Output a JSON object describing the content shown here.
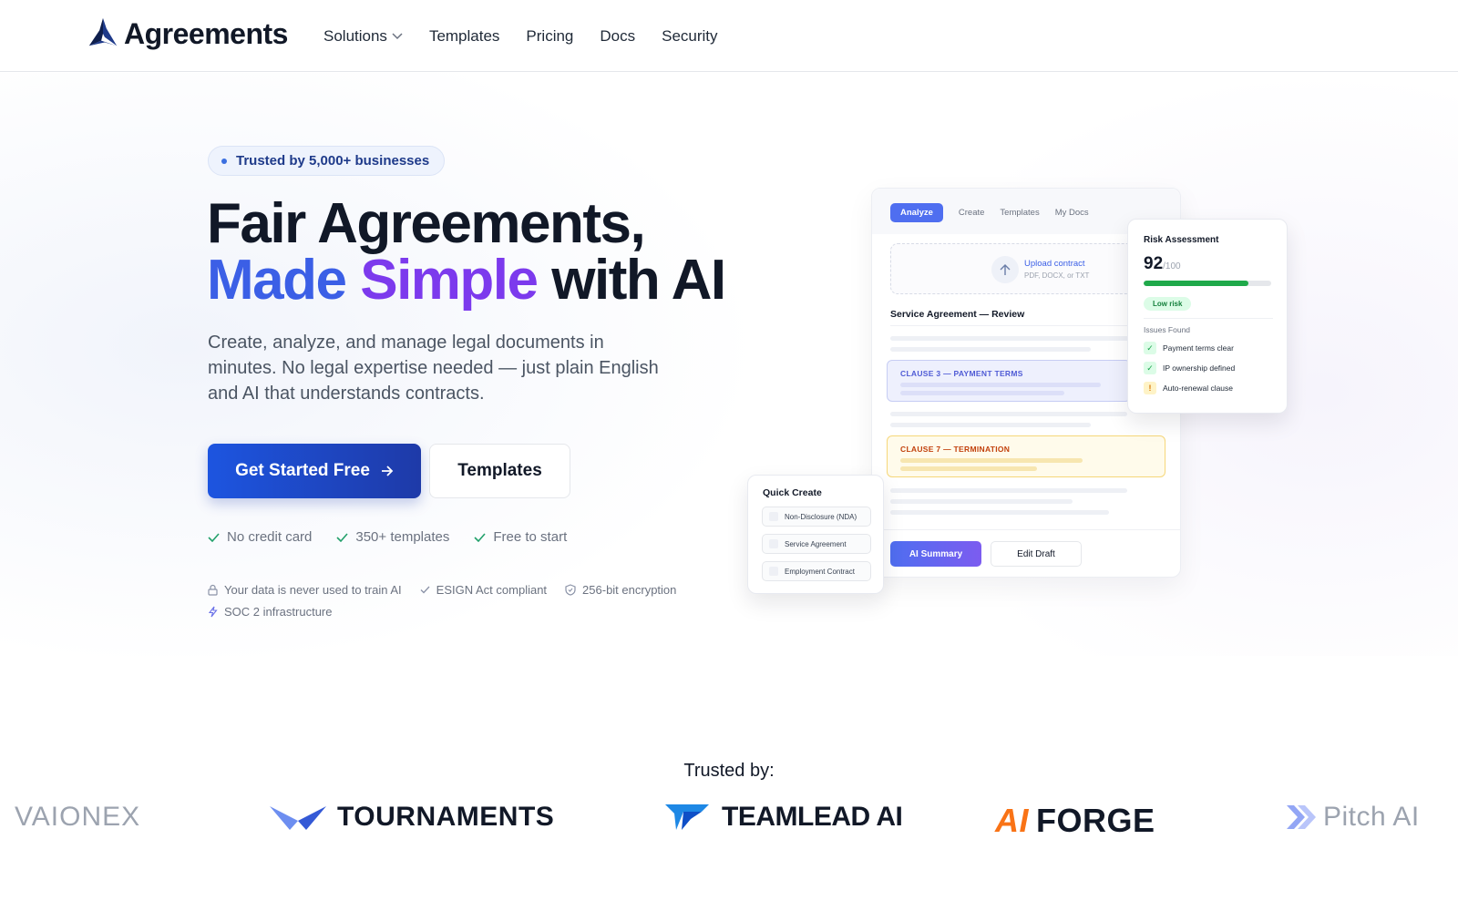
{
  "brand": {
    "name": "Agreements"
  },
  "nav": {
    "items": [
      {
        "label": "Solutions",
        "has_dropdown": true
      },
      {
        "label": "Templates"
      },
      {
        "label": "Pricing"
      },
      {
        "label": "Docs"
      },
      {
        "label": "Security"
      }
    ]
  },
  "hero": {
    "badge": "Trusted by 5,000+ businesses",
    "headline_line1": "Fair Agreements,",
    "headline_made": "Made",
    "headline_simple": "Simple",
    "headline_rest": "with AI",
    "subtitle": "Create, analyze, and manage legal documents in minutes. No legal expertise needed — just plain English and AI that understands contracts.",
    "primary_cta": "Get Started Free",
    "secondary_cta": "Templates",
    "checks": [
      "No credit card",
      "350+ templates",
      "Free to start"
    ],
    "trust": [
      "Your data is never used to train AI",
      "ESIGN Act compliant",
      "256-bit encryption",
      "SOC 2 infrastructure"
    ]
  },
  "mockup": {
    "tabs": [
      "Analyze",
      "Create",
      "Templates",
      "My Docs"
    ],
    "active_tab": "Analyze",
    "upload_title": "Upload contract",
    "upload_sub": "PDF, DOCX, or TXT",
    "doc_title": "Service Agreement — Review",
    "clause_a": "CLAUSE 3 — PAYMENT TERMS",
    "clause_b": "CLAUSE 7 — TERMINATION",
    "ai_button": "AI Summary",
    "edit_button": "Edit Draft"
  },
  "risk": {
    "title": "Risk Assessment",
    "score": "92",
    "max": "/100",
    "score_fraction": 0.82,
    "level": "Low risk",
    "issues_title": "Issues Found",
    "issues": [
      {
        "label": "Payment terms clear",
        "status": "ok",
        "icon": "✓"
      },
      {
        "label": "IP ownership defined",
        "status": "ok",
        "icon": "✓"
      },
      {
        "label": "Auto-renewal clause",
        "status": "warn",
        "icon": "!"
      }
    ]
  },
  "quick_create": {
    "title": "Quick Create",
    "items": [
      "Non-Disclosure (NDA)",
      "Service Agreement",
      "Employment Contract"
    ]
  },
  "trusted": {
    "title": "Trusted by:",
    "logos": [
      "VAIONEX",
      "TOURNAMENTS",
      "TEAMLEAD AI",
      "FORGE",
      "Pitch AI"
    ],
    "forge_prefix": "AI"
  },
  "colors": {
    "primary": "#1d55e0",
    "accent_blue": "#3b5fe6",
    "accent_purple": "#7c3aed",
    "success": "#1fa94a"
  }
}
